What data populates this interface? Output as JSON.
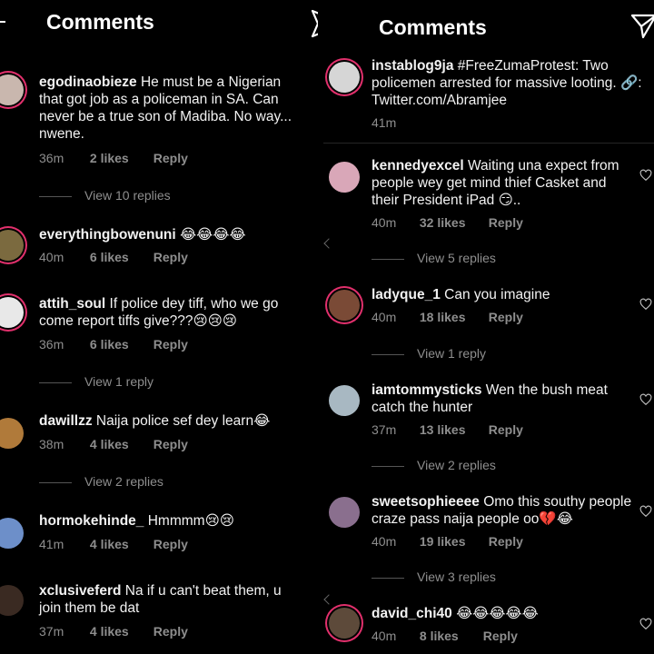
{
  "left": {
    "title": "Comments",
    "comments": [
      {
        "user": "egodinaobieze",
        "text": "He must be a Nigerian that got job as a policeman in SA. Can never be a true son of Madiba. No way... nwene.",
        "time": "36m",
        "likes": "2 likes",
        "reply": "Reply",
        "view_replies": "View 10 replies",
        "avatar_color": "#c9b7ae"
      },
      {
        "user": "everythingbowenuni",
        "text": "😂😂😂😂",
        "time": "40m",
        "likes": "6 likes",
        "reply": "Reply",
        "view_replies": "",
        "avatar_color": "#7b6a3f"
      },
      {
        "user": "attih_soul",
        "text": "If police dey tiff, who we go come report tiffs give???😢😢😢",
        "time": "36m",
        "likes": "6 likes",
        "reply": "Reply",
        "view_replies": "View 1 reply",
        "avatar_color": "#e8e8e8"
      },
      {
        "user": "dawillzz",
        "text": "Naija police sef dey learn😂",
        "time": "38m",
        "likes": "4 likes",
        "reply": "Reply",
        "view_replies": "View 2 replies",
        "avatar_color": "#b07a3a"
      },
      {
        "user": "hormokehinde_",
        "text": "Hmmmm😢😢",
        "time": "41m",
        "likes": "4 likes",
        "reply": "Reply",
        "view_replies": "",
        "avatar_color": "#6d8fc9"
      },
      {
        "user": "xclusiveferd",
        "text": "Na if u can't beat them, u join them be dat",
        "time": "37m",
        "likes": "4 likes",
        "reply": "Reply",
        "view_replies": "",
        "avatar_color": "#3a2a22"
      }
    ]
  },
  "right": {
    "title": "Comments",
    "caption": {
      "user": "instablog9ja",
      "text": "#FreeZumaProtest: Two policemen arrested for massive looting. 🔗: Twitter.com/Abramjee",
      "time": "41m",
      "avatar_color": "#d6d6d6"
    },
    "comments": [
      {
        "user": "kennedyexcel",
        "text": "Waiting una expect from people wey get mind thief Casket and their President iPad 😏..",
        "time": "40m",
        "likes": "32 likes",
        "reply": "Reply",
        "view_replies": "View 5 replies",
        "avatar_color": "#d9a7b8"
      },
      {
        "user": "ladyque_1",
        "text": "Can you imagine",
        "time": "40m",
        "likes": "18 likes",
        "reply": "Reply",
        "view_replies": "View 1 reply",
        "avatar_color": "#7a4a36"
      },
      {
        "user": "iamtommysticks",
        "text": "Wen the bush meat catch the hunter",
        "time": "37m",
        "likes": "13 likes",
        "reply": "Reply",
        "view_replies": "View 2 replies",
        "avatar_color": "#a8b8c2"
      },
      {
        "user": "sweetsophieeee",
        "text": "Omo this southy people craze pass naija people oo💔😂",
        "time": "40m",
        "likes": "19 likes",
        "reply": "Reply",
        "view_replies": "View 3 replies",
        "avatar_color": "#8a6f8e"
      },
      {
        "user": "david_chi40",
        "text": "😂😂😂😂😂",
        "time": "40m",
        "likes": "8 likes",
        "reply": "Reply",
        "view_replies": "",
        "avatar_color": "#5d4a3a"
      }
    ]
  }
}
